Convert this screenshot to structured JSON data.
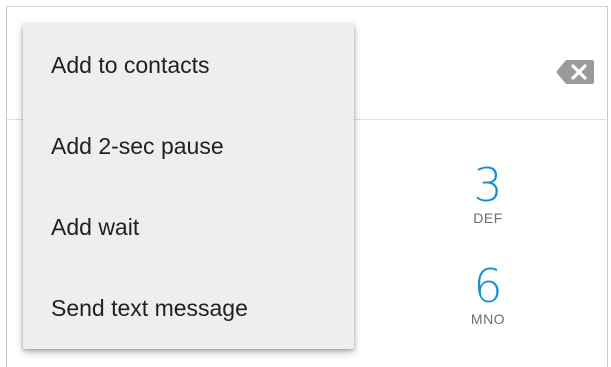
{
  "overflow_menu": {
    "items": [
      {
        "label": "Add to contacts"
      },
      {
        "label": "Add 2-sec pause"
      },
      {
        "label": "Add wait"
      },
      {
        "label": "Send text message"
      }
    ]
  },
  "number_bar": {
    "backspace_icon": "backspace-icon"
  },
  "keypad": {
    "keys": [
      {
        "digit": "3",
        "letters": "DEF"
      },
      {
        "digit": "6",
        "letters": "MNO"
      }
    ]
  },
  "colors": {
    "accent": "#1a8ed1",
    "menu_background": "#eeeeee",
    "menu_text": "#212121",
    "key_letters": "#6d6d6d",
    "backspace_icon": "#9a9a9a"
  }
}
